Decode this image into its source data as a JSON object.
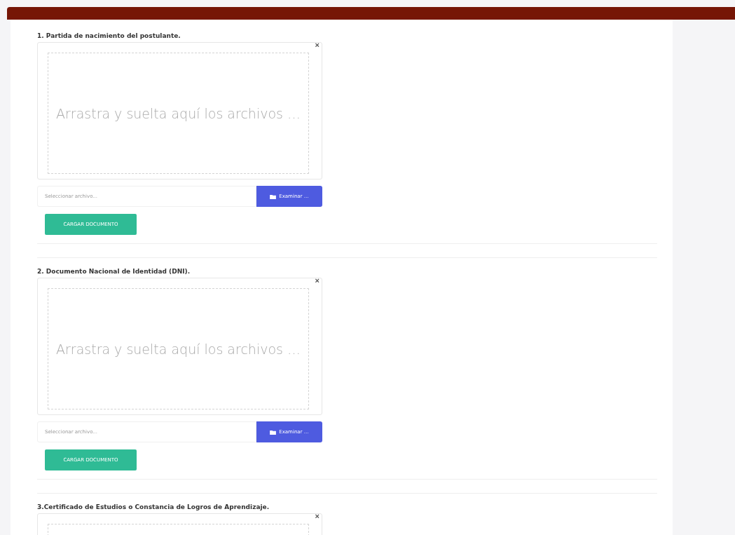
{
  "sections": [
    {
      "title": "1. Partida de nacimiento del postulante.",
      "close_label": "×",
      "dropzone_text": "Arrastra y suelta aquí los archivos …",
      "file_placeholder": "Seleccionar archivo...",
      "browse_label": "Examinar …",
      "upload_label": "CARGAR DOCUMENTO"
    },
    {
      "title": "2. Documento Nacional de Identidad (DNI).",
      "close_label": "×",
      "dropzone_text": "Arrastra y suelta aquí los archivos …",
      "file_placeholder": "Seleccionar archivo...",
      "browse_label": "Examinar …",
      "upload_label": "CARGAR DOCUMENTO"
    },
    {
      "title": "3.Certificado de Estudios o Constancia de Logros de Aprendizaje.",
      "close_label": "×"
    }
  ]
}
